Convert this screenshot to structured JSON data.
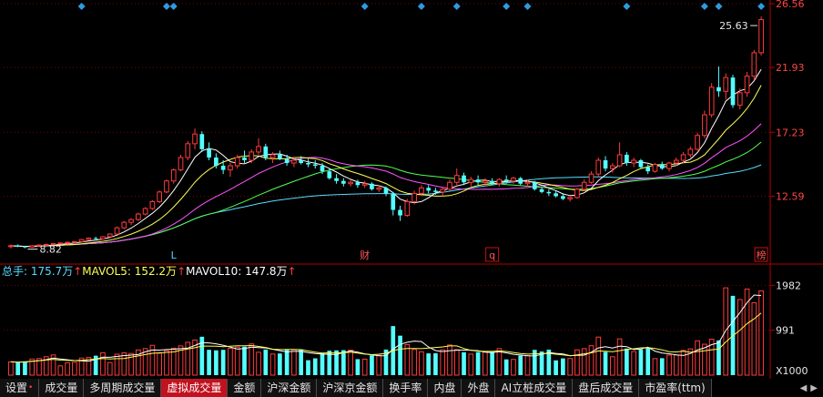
{
  "chart_data": {
    "type": "candlestick",
    "price_axis": {
      "ticks": [
        "26.56",
        "21.93",
        "17.23",
        "12.59"
      ],
      "tick_values": [
        26.56,
        21.93,
        17.23,
        12.59
      ]
    },
    "annotations": {
      "max_label": "25.63",
      "min_label": "8.82"
    },
    "markers": [
      "L",
      "财",
      "q",
      "榜"
    ],
    "candles": [
      [
        9.0,
        9.1,
        8.8,
        9.0
      ],
      [
        9.0,
        9.1,
        8.9,
        8.95
      ],
      [
        8.95,
        9.0,
        8.82,
        8.9
      ],
      [
        8.9,
        9.05,
        8.85,
        9.0
      ],
      [
        9.0,
        9.1,
        8.95,
        9.05
      ],
      [
        9.05,
        9.15,
        9.0,
        9.1
      ],
      [
        9.1,
        9.2,
        9.05,
        9.15
      ],
      [
        9.15,
        9.25,
        9.1,
        9.2
      ],
      [
        9.2,
        9.3,
        9.1,
        9.25
      ],
      [
        9.25,
        9.35,
        9.2,
        9.3
      ],
      [
        9.3,
        9.5,
        9.25,
        9.45
      ],
      [
        9.45,
        9.6,
        9.4,
        9.55
      ],
      [
        9.55,
        9.65,
        9.45,
        9.5
      ],
      [
        9.5,
        9.7,
        9.45,
        9.65
      ],
      [
        9.65,
        9.9,
        9.6,
        9.85
      ],
      [
        9.85,
        10.4,
        9.8,
        10.3
      ],
      [
        10.3,
        10.8,
        10.2,
        10.7
      ],
      [
        10.7,
        11.0,
        10.5,
        10.9
      ],
      [
        10.9,
        11.4,
        10.8,
        11.3
      ],
      [
        11.3,
        11.8,
        11.2,
        11.7
      ],
      [
        11.7,
        12.3,
        11.6,
        12.2
      ],
      [
        12.2,
        13.0,
        12.1,
        12.9
      ],
      [
        12.9,
        13.8,
        12.8,
        13.7
      ],
      [
        13.7,
        14.6,
        13.5,
        14.5
      ],
      [
        14.5,
        15.6,
        14.4,
        15.4
      ],
      [
        15.4,
        16.6,
        15.2,
        16.4
      ],
      [
        16.4,
        17.5,
        16.0,
        17.1
      ],
      [
        17.1,
        17.3,
        15.8,
        16.0
      ],
      [
        16.0,
        16.5,
        15.2,
        15.4
      ],
      [
        15.4,
        15.7,
        14.6,
        14.8
      ],
      [
        14.8,
        15.2,
        14.2,
        14.5
      ],
      [
        14.5,
        15.0,
        14.0,
        14.8
      ],
      [
        14.8,
        15.6,
        14.6,
        15.4
      ],
      [
        15.4,
        15.9,
        15.0,
        15.2
      ],
      [
        15.2,
        16.0,
        15.0,
        15.8
      ],
      [
        15.8,
        16.8,
        15.6,
        16.2
      ],
      [
        16.2,
        16.4,
        15.2,
        15.4
      ],
      [
        15.4,
        15.8,
        15.0,
        15.6
      ],
      [
        15.6,
        15.9,
        15.2,
        15.3
      ],
      [
        15.3,
        15.6,
        14.8,
        15.0
      ],
      [
        15.0,
        15.4,
        14.7,
        15.2
      ],
      [
        15.2,
        15.5,
        14.9,
        15.0
      ],
      [
        15.0,
        15.3,
        14.7,
        14.9
      ],
      [
        14.9,
        15.2,
        14.6,
        14.8
      ],
      [
        14.8,
        15.0,
        14.2,
        14.4
      ],
      [
        14.4,
        14.6,
        13.8,
        13.9
      ],
      [
        13.9,
        14.2,
        13.5,
        13.7
      ],
      [
        13.7,
        13.9,
        13.3,
        13.5
      ],
      [
        13.5,
        13.8,
        13.3,
        13.6
      ],
      [
        13.6,
        13.8,
        13.2,
        13.4
      ],
      [
        13.4,
        13.7,
        13.2,
        13.5
      ],
      [
        13.5,
        13.6,
        13.0,
        13.1
      ],
      [
        13.1,
        13.4,
        12.9,
        13.2
      ],
      [
        13.2,
        13.3,
        12.6,
        12.8
      ],
      [
        12.8,
        12.9,
        11.2,
        11.6
      ],
      [
        11.6,
        11.9,
        10.8,
        11.2
      ],
      [
        11.2,
        12.4,
        11.1,
        12.2
      ],
      [
        12.2,
        13.0,
        12.0,
        12.8
      ],
      [
        12.8,
        13.4,
        12.6,
        13.2
      ],
      [
        13.2,
        13.4,
        12.8,
        13.0
      ],
      [
        13.0,
        13.2,
        12.7,
        12.9
      ],
      [
        12.9,
        13.2,
        12.6,
        13.1
      ],
      [
        13.1,
        13.8,
        13.0,
        13.6
      ],
      [
        13.6,
        14.6,
        13.4,
        14.1
      ],
      [
        14.1,
        14.3,
        13.4,
        13.6
      ],
      [
        13.6,
        14.0,
        13.3,
        13.8
      ],
      [
        13.8,
        14.1,
        13.4,
        13.6
      ],
      [
        13.6,
        13.9,
        13.3,
        13.7
      ],
      [
        13.7,
        13.9,
        13.4,
        13.5
      ],
      [
        13.5,
        13.9,
        13.3,
        13.8
      ],
      [
        13.8,
        14.1,
        13.5,
        13.7
      ],
      [
        13.7,
        14.0,
        13.5,
        13.9
      ],
      [
        13.9,
        14.0,
        13.4,
        13.5
      ],
      [
        13.5,
        13.8,
        13.3,
        13.6
      ],
      [
        13.6,
        13.7,
        13.0,
        13.1
      ],
      [
        13.1,
        13.3,
        12.8,
        12.9
      ],
      [
        12.9,
        13.1,
        12.6,
        12.8
      ],
      [
        12.8,
        13.0,
        12.5,
        12.6
      ],
      [
        12.6,
        12.8,
        12.3,
        12.4
      ],
      [
        12.4,
        12.6,
        12.2,
        12.5
      ],
      [
        12.5,
        13.2,
        12.4,
        13.1
      ],
      [
        13.1,
        13.8,
        13.0,
        13.6
      ],
      [
        13.6,
        14.4,
        13.5,
        14.2
      ],
      [
        14.2,
        15.4,
        14.0,
        15.2
      ],
      [
        15.2,
        15.5,
        14.4,
        14.6
      ],
      [
        14.6,
        15.0,
        14.3,
        14.8
      ],
      [
        14.8,
        16.5,
        14.7,
        15.6
      ],
      [
        15.6,
        15.8,
        14.8,
        15.0
      ],
      [
        15.0,
        15.4,
        14.7,
        15.2
      ],
      [
        15.2,
        15.3,
        14.6,
        14.7
      ],
      [
        14.7,
        14.9,
        14.2,
        14.4
      ],
      [
        14.4,
        15.0,
        14.3,
        14.9
      ],
      [
        14.9,
        15.1,
        14.5,
        14.6
      ],
      [
        14.6,
        15.1,
        14.4,
        15.0
      ],
      [
        15.0,
        15.4,
        14.8,
        15.2
      ],
      [
        15.2,
        15.8,
        15.0,
        15.6
      ],
      [
        15.6,
        16.2,
        15.4,
        16.0
      ],
      [
        16.0,
        17.2,
        15.9,
        17.0
      ],
      [
        17.0,
        18.8,
        16.8,
        18.5
      ],
      [
        18.5,
        20.8,
        18.3,
        20.5
      ],
      [
        20.5,
        22.0,
        19.8,
        20.2
      ],
      [
        20.2,
        21.5,
        19.6,
        21.2
      ],
      [
        21.2,
        21.4,
        19.0,
        19.2
      ],
      [
        19.2,
        20.4,
        18.9,
        20.1
      ],
      [
        20.1,
        21.6,
        19.8,
        21.3
      ],
      [
        21.3,
        23.2,
        21.0,
        23.0
      ],
      [
        23.0,
        25.63,
        22.8,
        25.4
      ]
    ],
    "ma_series": [
      {
        "color": "#ffffff",
        "period": 5
      },
      {
        "color": "#ffff55",
        "period": 10
      },
      {
        "color": "#ff55ff",
        "period": 20
      },
      {
        "color": "#55ff55",
        "period": 30
      },
      {
        "color": "#55ddff",
        "period": 60
      }
    ],
    "volume": {
      "legend": {
        "total_label": "总手: ",
        "total_value": "175.7万",
        "total_color": "#55ddff",
        "ma5_label": "MAVOL5: ",
        "ma5_value": "152.2万",
        "ma5_color": "#ffff55",
        "ma10_label": "MAVOL10: ",
        "ma10_value": "147.8万",
        "ma10_color": "#ffffff",
        "arrow": "↑"
      },
      "ticks": [
        "1982",
        "991"
      ],
      "tick_values": [
        1982,
        991
      ],
      "unit": "X1000"
    }
  },
  "tabs": [
    {
      "label": "设置",
      "active": false,
      "dot": true
    },
    {
      "label": "成交量",
      "active": false
    },
    {
      "label": "多周期成交量",
      "active": false
    },
    {
      "label": "虚拟成交量",
      "active": true
    },
    {
      "label": "金额",
      "active": false
    },
    {
      "label": "沪深金额",
      "active": false
    },
    {
      "label": "沪深京金额",
      "active": false
    },
    {
      "label": "换手率",
      "active": false
    },
    {
      "label": "内盘",
      "active": false
    },
    {
      "label": "外盘",
      "active": false
    },
    {
      "label": "AI立桩成交量",
      "active": false
    },
    {
      "label": "盘后成交量",
      "active": false
    },
    {
      "label": "市盈率(ttm)",
      "active": false
    }
  ],
  "scroll": {
    "left": "◀",
    "right": "▶"
  },
  "colors": {
    "up": "#ff3b3b",
    "down": "#54ffff",
    "grid": "#7a0000",
    "axis": "#b00000",
    "text": "#e6e6e6"
  }
}
